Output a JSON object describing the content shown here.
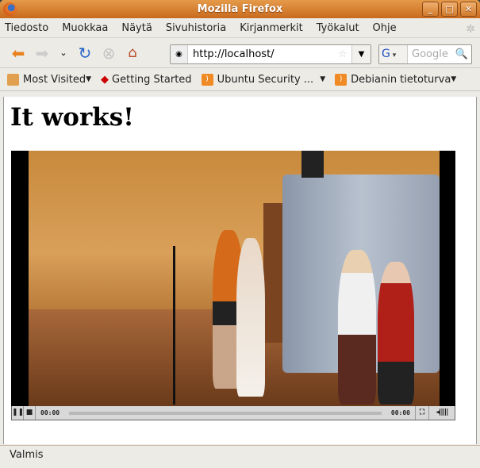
{
  "window": {
    "title": "Mozilla Firefox",
    "buttons": [
      "_",
      "□",
      "✕"
    ]
  },
  "menu": [
    {
      "u": "T",
      "rest": "iedosto"
    },
    {
      "u": "M",
      "rest": "uokkaa"
    },
    {
      "u": "N",
      "rest": "äytä"
    },
    {
      "u": "S",
      "rest": "ivuhistoria"
    },
    {
      "u": "K",
      "rest": "irjanmerkit"
    },
    {
      "u": "T",
      "rest": "yökalut",
      "pre": "Ty",
      "post": "ökalut"
    },
    {
      "u": "O",
      "rest": "hje"
    }
  ],
  "menu_labels": [
    "Tiedosto",
    "Muokkaa",
    "Näytä",
    "Sivuhistoria",
    "Kirjanmerkit",
    "Työkalut",
    "Ohje"
  ],
  "nav": {
    "url": "http://localhost/",
    "search_placeholder": "Google",
    "search_engine": "G"
  },
  "bookmarks": [
    "Most Visited",
    "Getting Started",
    "Ubuntu Security ...",
    "Debianin tietoturva"
  ],
  "page": {
    "heading": "It works!"
  },
  "video": {
    "current_time": "00:00",
    "duration": "00:00",
    "progress": 0
  },
  "status": "Valmis"
}
